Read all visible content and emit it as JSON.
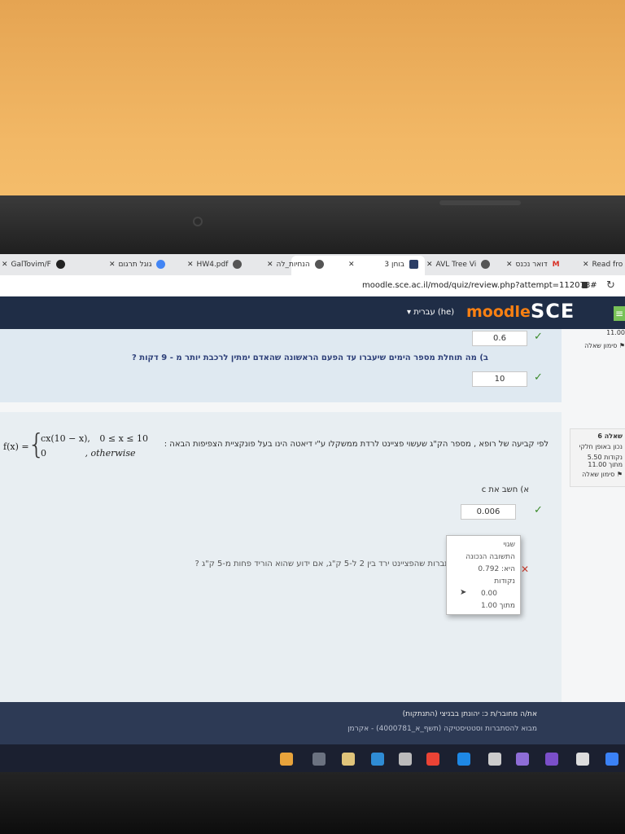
{
  "browser": {
    "tabs": [
      {
        "label": "GalTovim/F"
      },
      {
        "label": "גוגל תרגום"
      },
      {
        "label": "HW4.pdf"
      },
      {
        "label": "הנחיות_לה"
      },
      {
        "label": "בוחן 3"
      },
      {
        "label": "AVL Tree Vi"
      },
      {
        "label": "דואר נכנס"
      },
      {
        "label": "Read fro"
      }
    ],
    "url": "moodle.sce.ac.il/mod/quiz/review.php?attempt=112078#"
  },
  "header": {
    "language": "עברית (he)",
    "logo_moodle": "moodle",
    "logo_sce": "SCE"
  },
  "sidebar": {
    "flag_label": "סימון שאלה",
    "q6_label": "שאלה 6",
    "q6_status": "נכון באופן חלקי",
    "q6_points": "5.50 נקודות",
    "q6_max": "11.00 מתוך",
    "q6_flag": "סימון שאלה",
    "top_value": "11.00"
  },
  "question5": {
    "answer_a": "0.6",
    "part_b": "ב) מה תוחלת מספר הימים שיעברו עד הפעם הראשונה שהאדם ימתין לרכבת יותר מ - 9 דקות ?",
    "answer_b": "10"
  },
  "question6": {
    "text": "לפי קביעה של רופא , מספר הק\"ג שעשוי פציינט לרדת ממשקלו ע\"י דיאטה הינו בעל פונקציית הצפיפות הבאה :",
    "formula_lhs": "f(x) =",
    "case1_expr": "cx(10 − x),",
    "case1_cond": "0 ≤ x ≤ 10",
    "case2_expr": "0",
    "case2_cond": ", otherwise",
    "part_a": "א)  חשב את c",
    "answer_a": "0.006",
    "part_b": "ב) מהי ההסתברות שהפציינט ירד בין 2 ל-5 ק\"ג, אם ידוע שהוא הוריד פחות מ-5 ק\"ג ?"
  },
  "popup": {
    "status": "שגוי",
    "correct_label": "התשובה הנכונה",
    "correct_value": "היא: 0.792",
    "points_label": "נקודות",
    "points_value": "0.00",
    "max_label": "מתוך",
    "max_value": "1.00"
  },
  "footer": {
    "logged_in": "את/ה מחובר/ת כ: יהונתן בבניצי (התנתקות)",
    "course": "מבוא להסתברות וסטטיסטיקה (תשף_א_4000781) - אקרמן"
  }
}
